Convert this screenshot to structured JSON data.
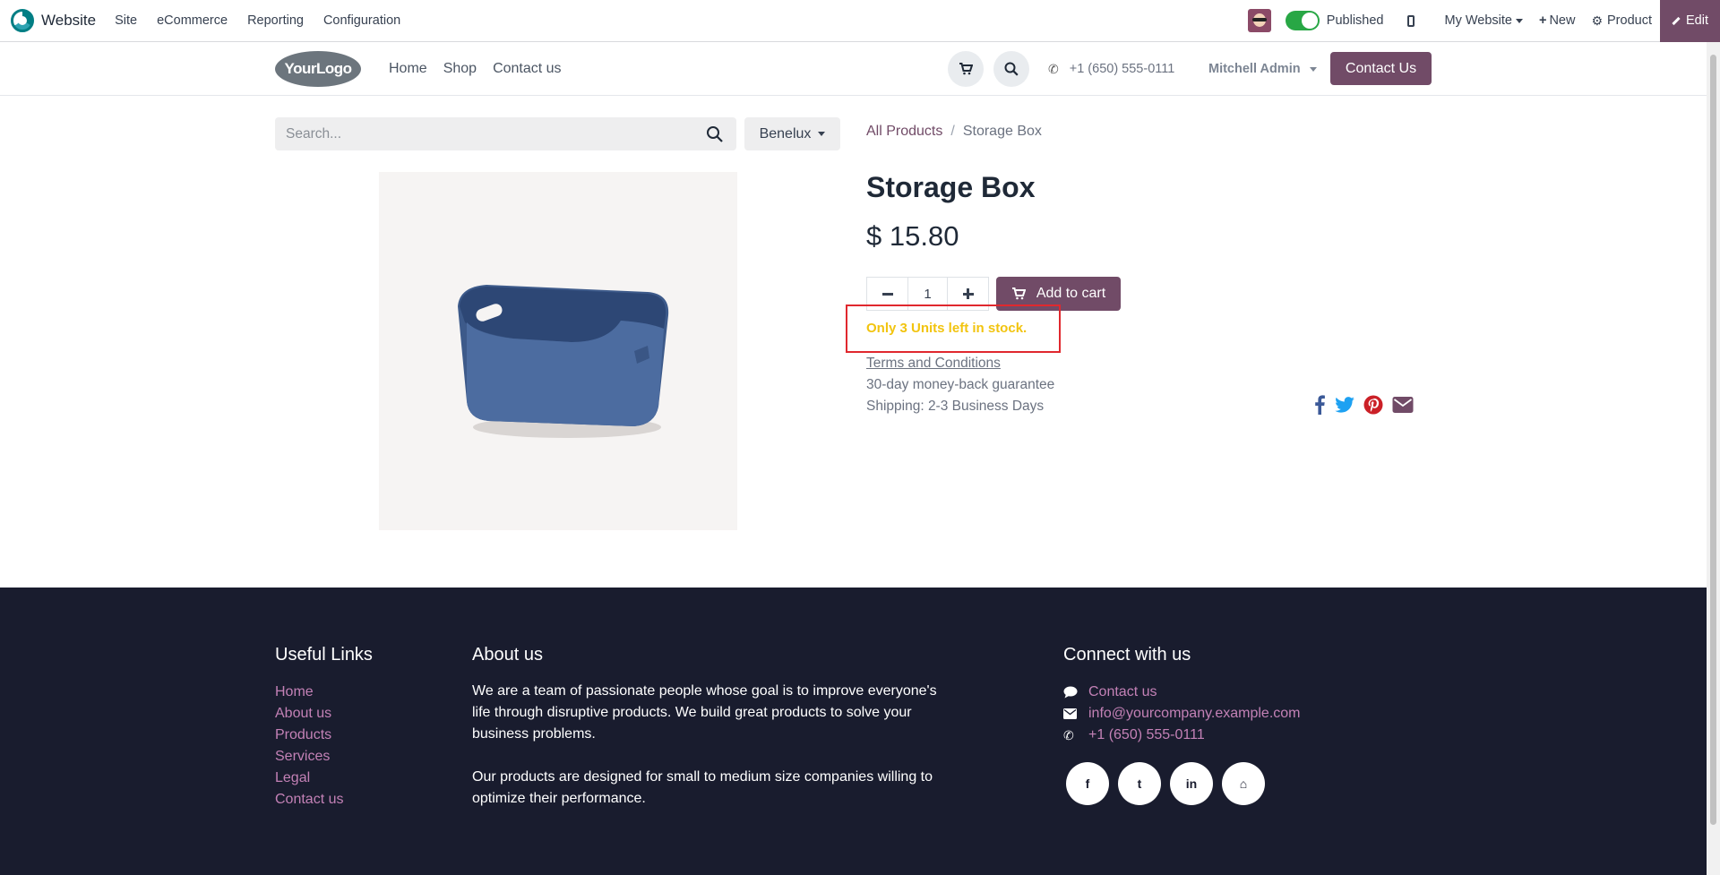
{
  "admin_bar": {
    "app_name": "Website",
    "menu": [
      "Site",
      "eCommerce",
      "Reporting",
      "Configuration"
    ],
    "published_label": "Published",
    "website_selector": "My Website",
    "new_label": "New",
    "product_label": "Product",
    "edit_label": "Edit"
  },
  "header": {
    "logo_text": "YourLogo",
    "nav": [
      "Home",
      "Shop",
      "Contact us"
    ],
    "phone": "+1 (650) 555-0111",
    "user": "Mitchell Admin",
    "contact_button": "Contact Us"
  },
  "search": {
    "placeholder": "Search...",
    "pricelist": "Benelux"
  },
  "breadcrumb": {
    "parent": "All Products",
    "separator": "/",
    "current": "Storage Box"
  },
  "product": {
    "name": "Storage Box",
    "price": "$ 15.80",
    "quantity": "1",
    "add_to_cart": "Add to cart",
    "stock_message": "Only 3 Units left in stock.",
    "terms": "Terms and Conditions",
    "guarantee": "30-day money-back guarantee",
    "shipping": "Shipping: 2-3 Business Days",
    "share_icons": [
      "facebook-icon",
      "twitter-icon",
      "pinterest-icon",
      "envelope-icon"
    ]
  },
  "footer": {
    "useful_links_title": "Useful Links",
    "useful_links": [
      "Home",
      "About us",
      "Products",
      "Services",
      "Legal",
      "Contact us"
    ],
    "about_title": "About us",
    "about_p1": "We are a team of passionate people whose goal is to improve everyone's life through disruptive products. We build great products to solve your business problems.",
    "about_p2": "Our products are designed for small to medium size companies willing to optimize their performance.",
    "connect_title": "Connect with us",
    "contact_link": "Contact us",
    "email": "info@yourcompany.example.com",
    "phone": "+1 (650) 555-0111",
    "social": [
      "f",
      "t",
      "in",
      "⌂"
    ]
  },
  "colors": {
    "brand": "#714b67",
    "footer_bg": "#191c2e",
    "footer_link": "#c381b6",
    "stock_warning": "#f2c40f",
    "highlight_box": "#e0282e"
  }
}
